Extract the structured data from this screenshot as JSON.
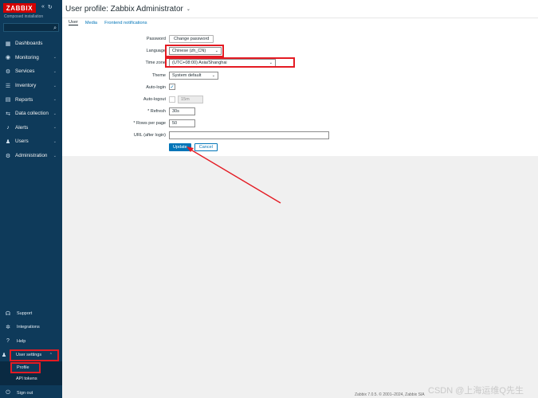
{
  "sidebar": {
    "logo": "ZABBIX",
    "installation": "Composed installation",
    "search_placeholder": "",
    "menu": [
      {
        "label": "Dashboards",
        "icon": "dashboard-icon",
        "chevron": false
      },
      {
        "label": "Monitoring",
        "icon": "eye-icon",
        "chevron": true
      },
      {
        "label": "Services",
        "icon": "services-icon",
        "chevron": true
      },
      {
        "label": "Inventory",
        "icon": "inventory-icon",
        "chevron": true
      },
      {
        "label": "Reports",
        "icon": "reports-icon",
        "chevron": true
      },
      {
        "label": "Data collection",
        "icon": "data-collection-icon",
        "chevron": true
      },
      {
        "label": "Alerts",
        "icon": "bell-icon",
        "chevron": true
      },
      {
        "label": "Users",
        "icon": "users-icon",
        "chevron": true
      },
      {
        "label": "Administration",
        "icon": "gear-icon",
        "chevron": true
      }
    ],
    "bottom": {
      "support": "Support",
      "integrations": "Integrations",
      "help": "Help",
      "user_settings": "User settings",
      "profile": "Profile",
      "api_tokens": "API tokens",
      "sign_out": "Sign out"
    }
  },
  "header": {
    "title": "User profile: Zabbix Administrator"
  },
  "tabs": [
    "User",
    "Media",
    "Frontend notifications"
  ],
  "form": {
    "password_label": "Password",
    "change_password_button": "Change password",
    "language_label": "Language",
    "language_value": "Chinese (zh_CN)",
    "timezone_label": "Time zone",
    "timezone_value": "(UTC+08:00) Asia/Shanghai",
    "theme_label": "Theme",
    "theme_value": "System default",
    "autologin_label": "Auto-login",
    "autologin_checked": true,
    "autologout_label": "Auto-logout",
    "autologout_checked": false,
    "autologout_value": "15m",
    "refresh_label": "* Refresh",
    "refresh_value": "30s",
    "rows_per_page_label": "* Rows per page",
    "rows_per_page_value": "50",
    "url_label": "URL (after login)",
    "url_value": "",
    "update_button": "Update",
    "cancel_button": "Cancel"
  },
  "footer": "Zabbix 7.0.5. © 2001–2024, Zabbix SIA",
  "watermark": "CSDN @上海运维Q先生",
  "colors": {
    "sidebar_bg": "#0e3a5a",
    "logo_red": "#d40000",
    "highlight_red": "#e41b23",
    "primary_blue": "#0275b8"
  }
}
